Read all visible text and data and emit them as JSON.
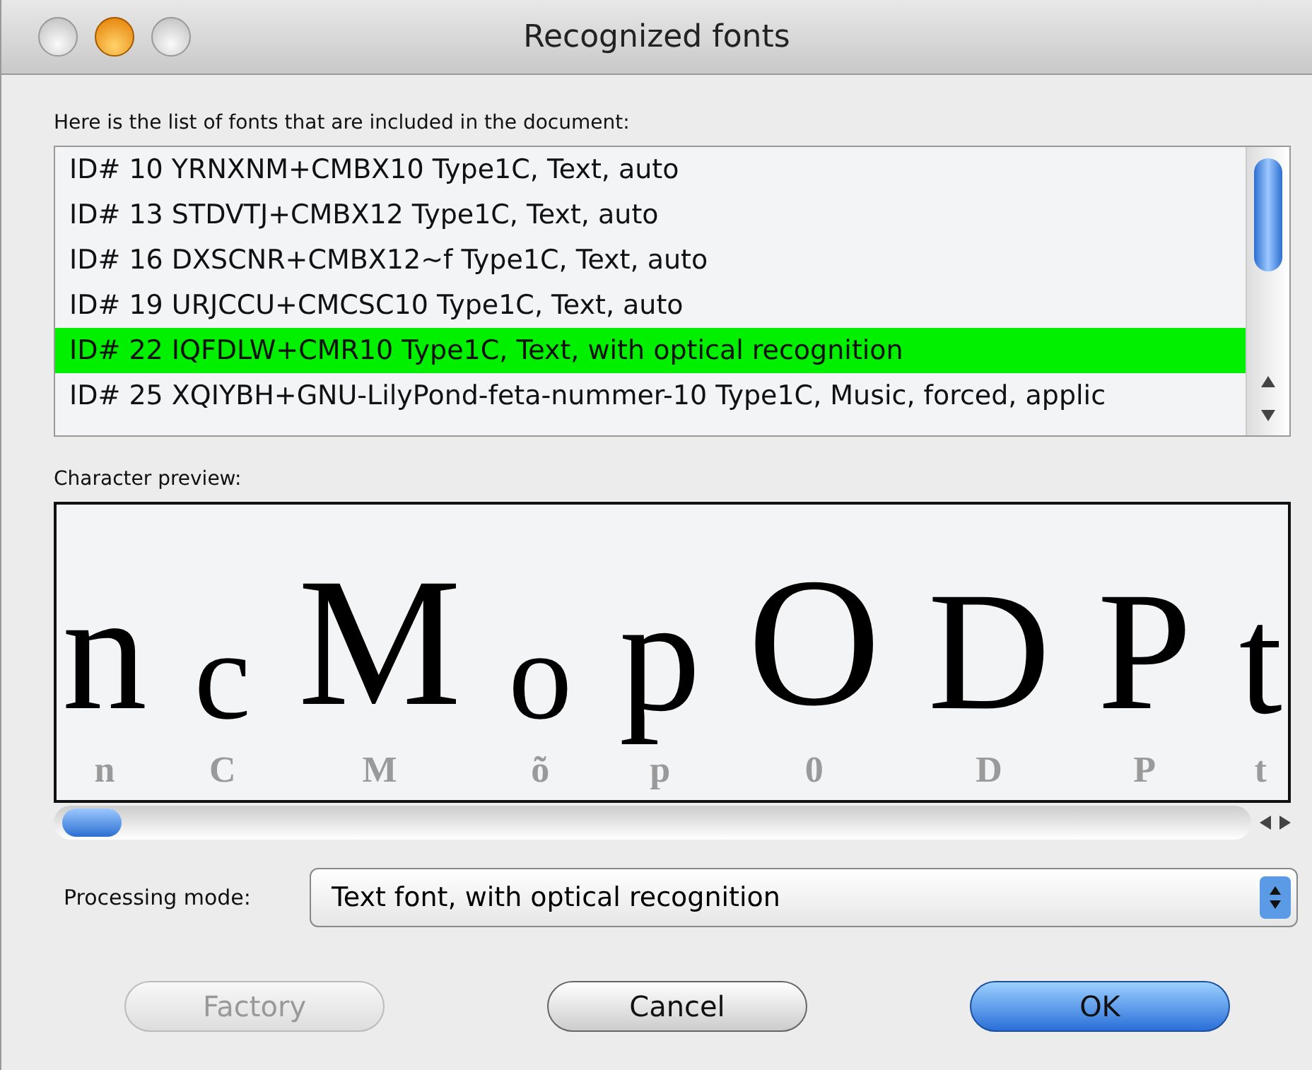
{
  "window": {
    "title": "Recognized fonts"
  },
  "list_label": "Here is the list of fonts that are included in the document:",
  "fonts": [
    {
      "text": "ID# 10 YRNXNM+CMBX10 Type1C, Text, auto",
      "selected": false
    },
    {
      "text": "ID# 13 STDVTJ+CMBX12 Type1C, Text, auto",
      "selected": false
    },
    {
      "text": "ID# 16 DXSCNR+CMBX12~f Type1C, Text, auto",
      "selected": false
    },
    {
      "text": "ID# 19 URJCCU+CMCSC10 Type1C, Text, auto",
      "selected": false
    },
    {
      "text": "ID# 22 IQFDLW+CMR10 Type1C, Text, with optical recognition",
      "selected": true
    },
    {
      "text": "ID# 25 XQIYBH+GNU-LilyPond-feta-nummer-10 Type1C, Music, forced, applic",
      "selected": false
    }
  ],
  "preview_label": "Character preview:",
  "preview": [
    {
      "glyph": "n",
      "recognized": "n"
    },
    {
      "glyph": "c",
      "recognized": "C"
    },
    {
      "glyph": "M",
      "recognized": "M"
    },
    {
      "glyph": "o",
      "recognized": "õ"
    },
    {
      "glyph": "p",
      "recognized": "p"
    },
    {
      "glyph": "O",
      "recognized": "0"
    },
    {
      "glyph": "D",
      "recognized": "D"
    },
    {
      "glyph": "P",
      "recognized": "P"
    },
    {
      "glyph": "t",
      "recognized": "t"
    }
  ],
  "processing_mode": {
    "label": "Processing mode:",
    "value": "Text font, with optical recognition"
  },
  "buttons": [
    {
      "label": "Factory",
      "disabled": true,
      "default": false
    },
    {
      "label": "Cancel",
      "disabled": false,
      "default": false
    },
    {
      "label": "OK",
      "disabled": false,
      "default": true
    }
  ]
}
